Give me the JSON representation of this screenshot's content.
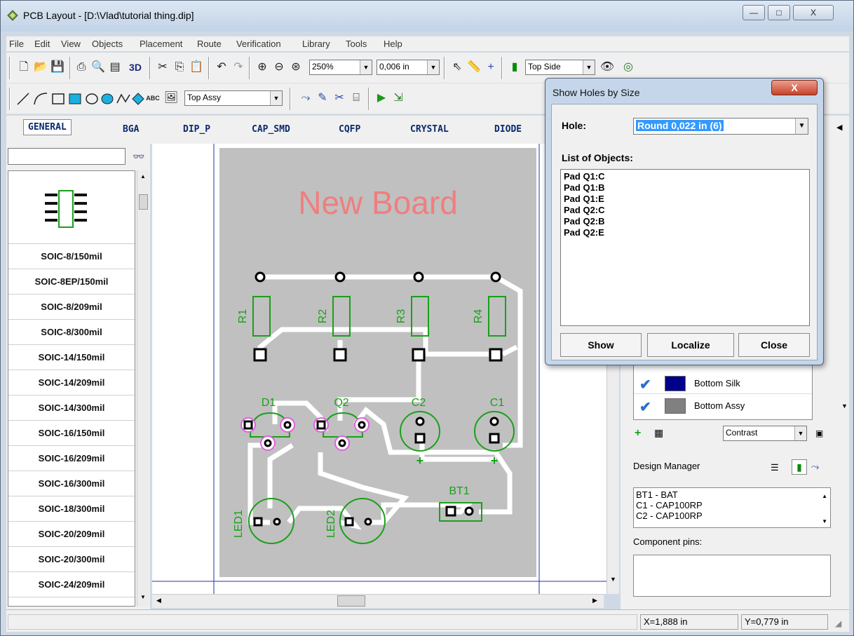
{
  "window": {
    "title": "PCB Layout - [D:\\Vlad\\tutorial thing.dip]",
    "min": "—",
    "max": "□",
    "close": "X"
  },
  "menu": [
    "File",
    "Edit",
    "View",
    "Objects",
    "Placement",
    "Route",
    "Verification",
    "Library",
    "Tools",
    "Help"
  ],
  "toolbar1": {
    "label_3d": "3D",
    "zoom": "250%",
    "grid": "0,006 in",
    "side": "Top Side"
  },
  "toolbar2": {
    "text_tool": "ABC",
    "layer": "Top Assy"
  },
  "lib_tabs": [
    "GENERAL",
    "BGA",
    "DIP_P",
    "CAP_SMD",
    "CQFP",
    "CRYSTAL",
    "DIODE"
  ],
  "parts": [
    "SOIC-8/150mil",
    "SOIC-8EP/150mil",
    "SOIC-8/209mil",
    "SOIC-8/300mil",
    "SOIC-14/150mil",
    "SOIC-14/209mil",
    "SOIC-14/300mil",
    "SOIC-16/150mil",
    "SOIC-16/209mil",
    "SOIC-16/300mil",
    "SOIC-18/300mil",
    "SOIC-20/209mil",
    "SOIC-20/300mil",
    "SOIC-24/209mil"
  ],
  "board": {
    "title": "New Board",
    "resistors": [
      "R1",
      "R2",
      "R3",
      "R4"
    ],
    "d1": "D1",
    "q2": "Q2",
    "c2": "C2",
    "c1": "C1",
    "led1": "LED1",
    "led2": "LED2",
    "bt1": "BT1",
    "colors": {
      "board": "#c0c0c0",
      "silk": "#1aa01a",
      "title": "#f07e7e",
      "track": "#ffffff",
      "pad": "#000000",
      "hole_highlight": "#e060e0"
    }
  },
  "layers": [
    {
      "name": "Bottom Silk",
      "color": "#00008b"
    },
    {
      "name": "Bottom Assy",
      "color": "#808080"
    }
  ],
  "contrast": "Contrast",
  "design_manager": {
    "title": "Design Manager",
    "items": [
      "BT1 - BAT",
      "C1 - CAP100RP",
      "C2 - CAP100RP"
    ]
  },
  "component_pins": "Component pins:",
  "status": {
    "x": "X=1,888 in",
    "y": "Y=0,779 in"
  },
  "dialog": {
    "title": "Show Holes by Size",
    "close_x": "X",
    "hole_label": "Hole:",
    "hole_value": "Round 0,022 in (6)",
    "list_label": "List of Objects:",
    "objects": [
      "Pad Q1:C",
      "Pad Q1:B",
      "Pad Q1:E",
      "Pad Q2:C",
      "Pad Q2:B",
      "Pad Q2:E"
    ],
    "buttons": {
      "show": "Show",
      "localize": "Localize",
      "close": "Close"
    }
  }
}
